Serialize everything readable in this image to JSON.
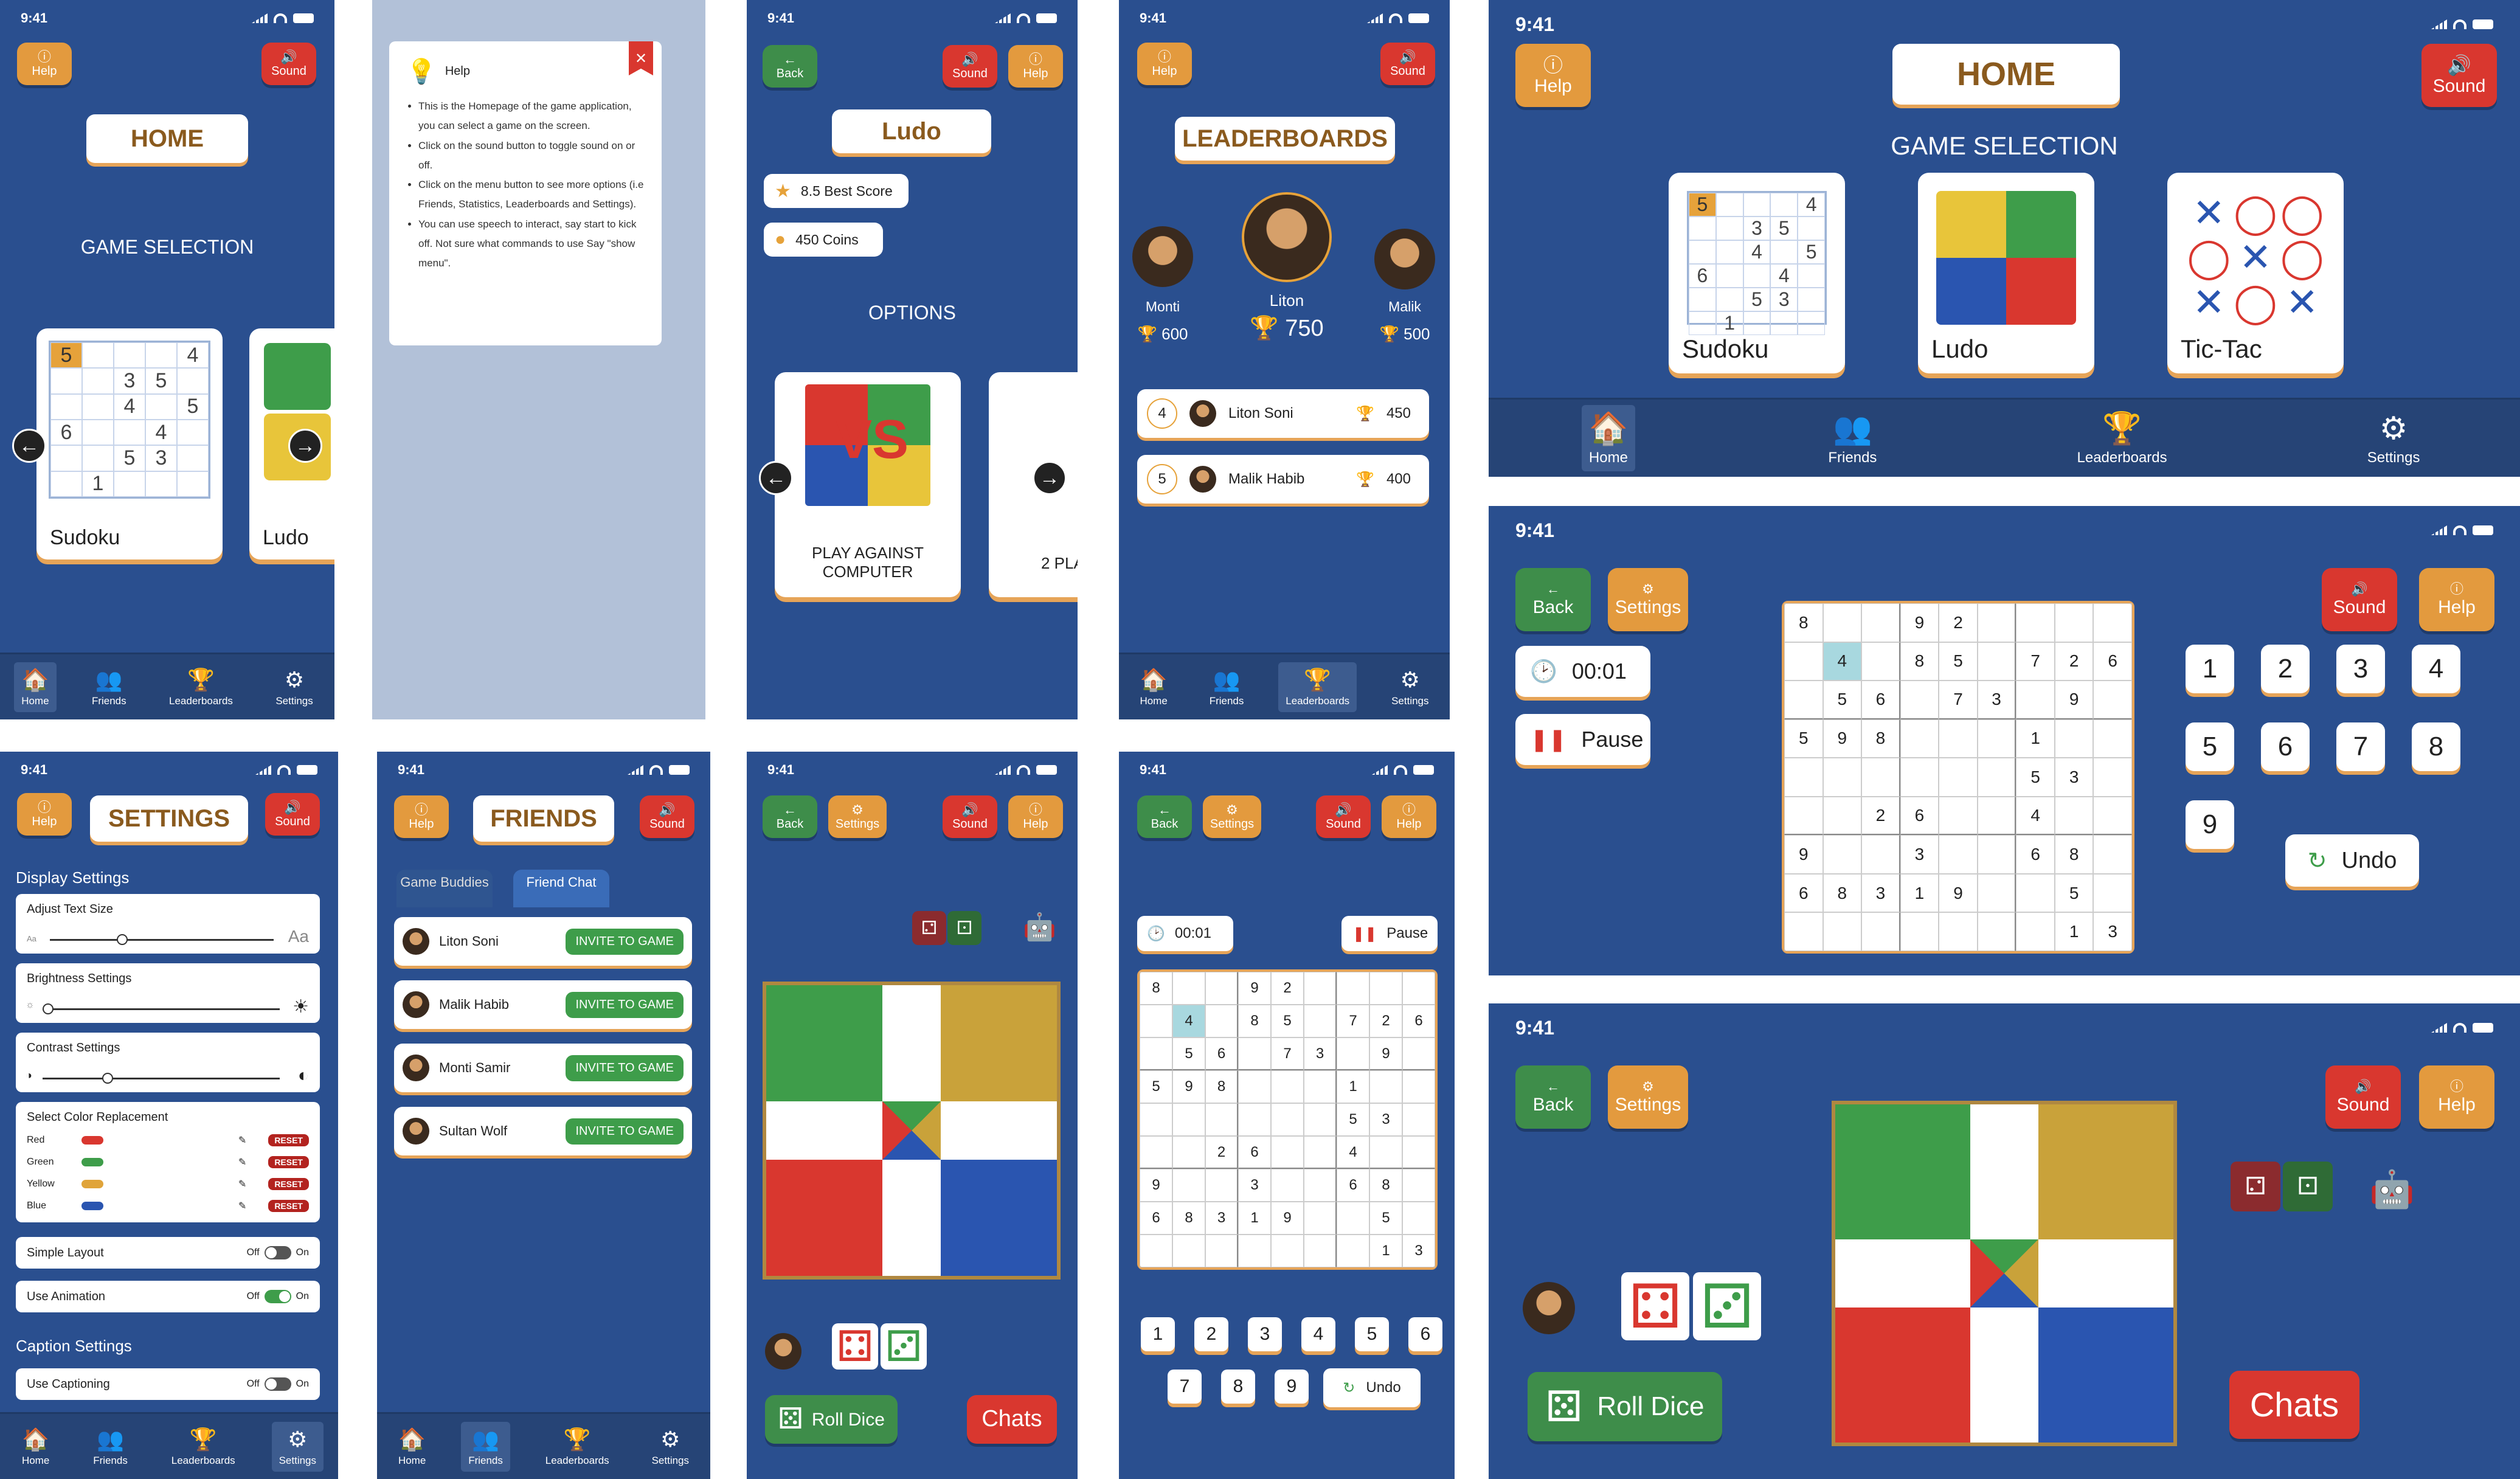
{
  "time": "9:41",
  "common": {
    "help": "Help",
    "sound": "Sound",
    "back": "Back",
    "settings": "Settings",
    "nav": [
      "Home",
      "Friends",
      "Leaderboards",
      "Settings"
    ]
  },
  "home": {
    "title": "HOME",
    "subtitle": "GAME SELECTION",
    "games": [
      "Sudoku",
      "Ludo",
      "Tic-Tac"
    ]
  },
  "help_dialog": {
    "title": "Help",
    "bullets": [
      "This is the Homepage of the game application, you can select a game on the screen.",
      "Click on the sound button to toggle sound on or off.",
      "Click on the menu button to see more options (i.e Friends, Statistics, Leaderboards and Settings).",
      "You can use speech to interact, say start to kick off. Not sure what commands to use Say \"show menu\"."
    ]
  },
  "ludo_options": {
    "title": "Ludo",
    "best": "8.5 Best Score",
    "coins": "450 Coins",
    "options_label": "OPTIONS",
    "vs_badge": "VS",
    "cards": [
      "PLAY AGAINST COMPUTER",
      "2 PLA"
    ]
  },
  "leaderboards": {
    "title": "LEADERBOARDS",
    "podium": [
      {
        "name": "Monti",
        "score": "600",
        "rank": "2"
      },
      {
        "name": "Liton",
        "score": "750",
        "rank": "1"
      },
      {
        "name": "Malik",
        "score": "500",
        "rank": "3"
      }
    ],
    "rows": [
      {
        "rank": "4",
        "name": "Liton Soni",
        "score": "450"
      },
      {
        "rank": "5",
        "name": "Malik Habib",
        "score": "400"
      }
    ]
  },
  "settings_page": {
    "title": "SETTINGS",
    "display": "Display Settings",
    "text_size": "Adjust Text Size",
    "aa_small": "Aa",
    "aa_big": "Aa",
    "brightness": "Brightness Settings",
    "contrast": "Contrast Settings",
    "color_replacement": "Select Color Replacement",
    "colors": [
      {
        "name": "Red",
        "hex": "#d9372f"
      },
      {
        "name": "Green",
        "hex": "#3e9d4a"
      },
      {
        "name": "Yellow",
        "hex": "#e0a43a"
      },
      {
        "name": "Blue",
        "hex": "#2a55b0"
      }
    ],
    "reset": "RESET",
    "simple_layout": "Simple Layout",
    "use_animation": "Use Animation",
    "off": "Off",
    "on": "On",
    "caption": "Caption Settings",
    "use_captioning": "Use Captioning"
  },
  "friends": {
    "title": "FRIENDS",
    "tabs": [
      "Game Buddies",
      "Friend Chat"
    ],
    "invite": "INVITE TO GAME",
    "people": [
      "Liton Soni",
      "Malik Habib",
      "Monti Samir",
      "Sultan Wolf"
    ]
  },
  "ludo_game": {
    "roll": "Roll Dice",
    "chats": "Chats"
  },
  "sudoku_game": {
    "timer": "00:01",
    "pause": "Pause",
    "undo": "Undo",
    "keys": [
      "1",
      "2",
      "3",
      "4",
      "5",
      "6",
      "7",
      "8",
      "9"
    ],
    "grid": [
      [
        "8",
        "",
        "",
        "9",
        "2",
        "",
        "",
        "",
        ""
      ],
      [
        "",
        "4",
        "",
        "8",
        "5",
        "",
        "7",
        "2",
        "6"
      ],
      [
        "",
        "5",
        "6",
        "",
        "7",
        "3",
        "",
        "9",
        ""
      ],
      [
        "5",
        "9",
        "8",
        "",
        "",
        "",
        "1",
        "",
        ""
      ],
      [
        "",
        "",
        "",
        "",
        "",
        "",
        "5",
        "3",
        ""
      ],
      [
        "",
        "",
        "2",
        "6",
        "",
        "",
        "4",
        "",
        ""
      ],
      [
        "9",
        "",
        "",
        "3",
        "",
        "",
        "6",
        "8",
        ""
      ],
      [
        "6",
        "8",
        "3",
        "1",
        "9",
        "",
        "",
        "5",
        ""
      ],
      [
        "",
        "",
        "",
        "",
        "",
        "",
        "",
        "1",
        "3"
      ]
    ]
  },
  "thumb_sudoku": [
    [
      "5",
      "",
      "",
      "",
      "4"
    ],
    [
      "",
      "",
      "3",
      "5",
      ""
    ],
    [
      "",
      "",
      "4",
      "",
      "5"
    ],
    [
      "6",
      "",
      "",
      "4",
      ""
    ],
    [
      "",
      "",
      "5",
      "3",
      ""
    ],
    [
      "",
      "1",
      "",
      "",
      ""
    ]
  ]
}
